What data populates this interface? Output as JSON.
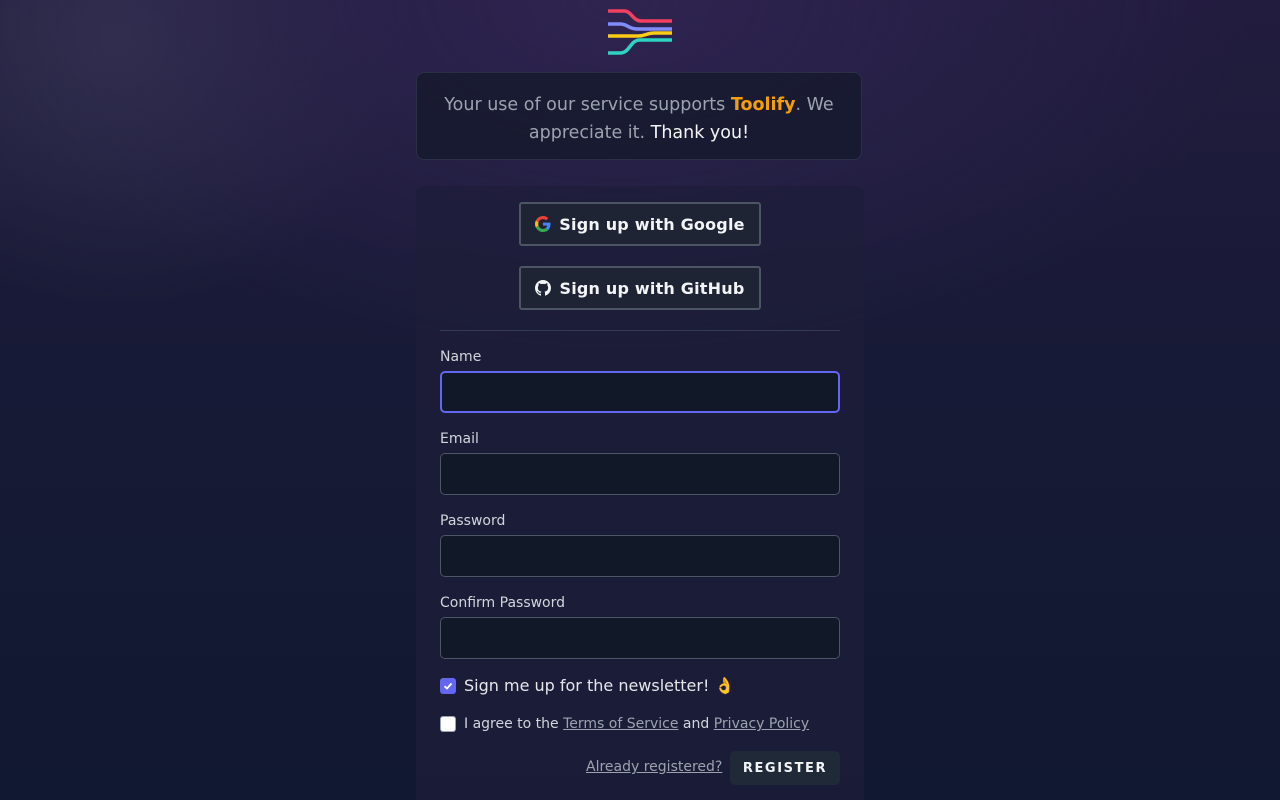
{
  "logo": {
    "icon": "wave-lines-logo",
    "colors": [
      "#f43f5e",
      "#818cf8",
      "#facc15",
      "#2dd4bf"
    ]
  },
  "support": {
    "text_before": "Your use of our service supports ",
    "brand": "Toolify",
    "text_after": ". We appreciate it. ",
    "thanks": "Thank you!"
  },
  "oauth": {
    "google_label": "Sign up with Google",
    "github_label": "Sign up with GitHub"
  },
  "form": {
    "name_label": "Name",
    "name_value": "",
    "email_label": "Email",
    "email_value": "",
    "password_label": "Password",
    "password_value": "",
    "confirm_label": "Confirm Password",
    "confirm_value": "",
    "newsletter_label": "Sign me up for the newsletter! 👌",
    "newsletter_checked": true,
    "terms_prefix": "I agree to the ",
    "terms_link": "Terms of Service",
    "terms_and": " and ",
    "privacy_link": "Privacy Policy",
    "terms_checked": false,
    "already_registered": "Already registered?",
    "register_label": "REGISTER"
  },
  "colors": {
    "accent": "#6366f1",
    "brand": "#f59e0b"
  }
}
